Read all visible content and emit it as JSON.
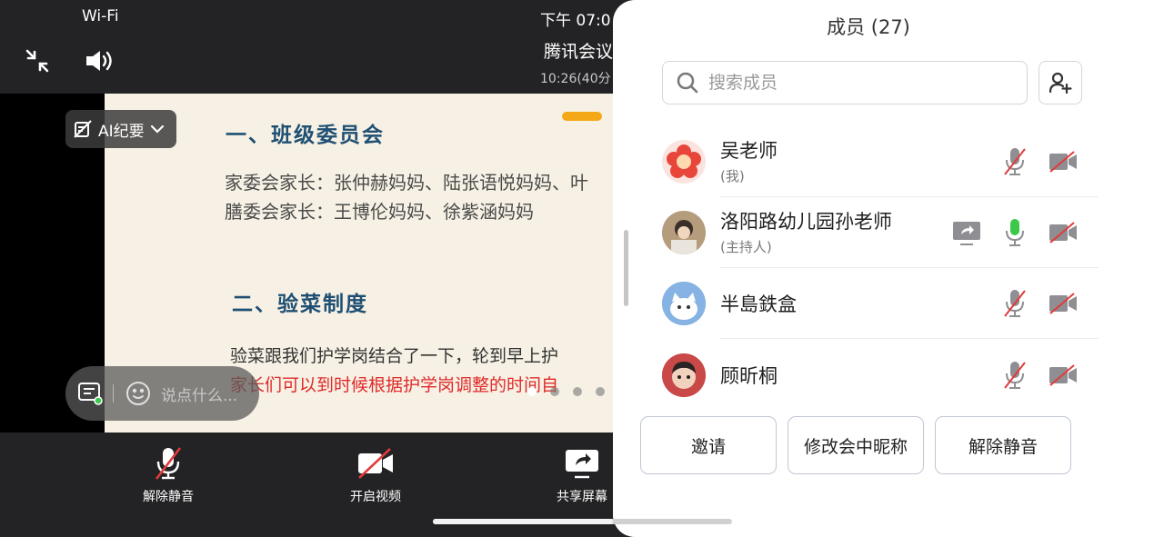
{
  "status": {
    "wifi": "Wi-Fi",
    "time": "下午 07:0"
  },
  "meeting": {
    "title": "腾讯会议",
    "subtitle": "10:26(40分"
  },
  "slide": {
    "heading1": "一、班级委员会",
    "line1": "家委会家长：张仲赫妈妈、陆张语悦妈妈、叶",
    "line2": "膳委会家长：王博伦妈妈、徐紫涵妈妈",
    "heading2": "二、验菜制度",
    "line3": "验菜跟我们护学岗结合了一下，轮到早上护",
    "line4": "家长们可以到时候根据护学岗调整的时间自"
  },
  "ai_summary": {
    "label": "AI纪要"
  },
  "chat": {
    "placeholder": "说点什么..."
  },
  "toolbar": {
    "unmute_label": "解除静音",
    "video_label": "开启视频",
    "share_label": "共享屏幕"
  },
  "panel": {
    "title": "成员 (27)",
    "search_placeholder": "搜索成员",
    "members": [
      {
        "name": "吴老师",
        "role": "(我)",
        "mic": "muted",
        "camera": "off"
      },
      {
        "name": "洛阳路幼儿园孙老师",
        "role": "(主持人)",
        "mic": "on",
        "camera": "off",
        "sharing": true
      },
      {
        "name": "半島鉄盒",
        "role": "",
        "mic": "muted",
        "camera": "off"
      },
      {
        "name": "顾昕桐",
        "role": "",
        "mic": "muted",
        "camera": "off"
      }
    ],
    "actions": {
      "invite": "邀请",
      "rename": "修改会中昵称",
      "unmute": "解除静音"
    }
  },
  "colors": {
    "mic_on": "#3cc84a",
    "muted_red": "#e23b3b",
    "heading": "#1f4f73",
    "accent": "#f5a817"
  }
}
